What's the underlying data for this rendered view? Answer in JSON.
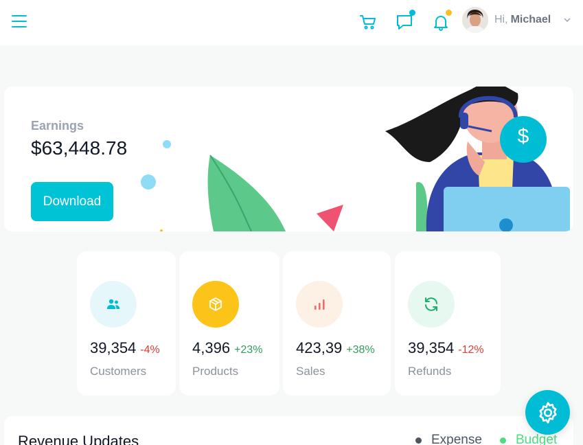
{
  "header": {
    "greeting": "Hi,",
    "user_name": "Michael",
    "icons": [
      "menu-icon",
      "cart-icon",
      "chat-icon",
      "bell-icon",
      "chevron-down-icon"
    ]
  },
  "earnings": {
    "label": "Earnings",
    "value": "$63,448.78",
    "download_label": "Download",
    "badge_symbol": "$"
  },
  "stats": [
    {
      "value": "39,354",
      "change": "-4%",
      "label": "Customers",
      "icon": "customers-icon"
    },
    {
      "value": "4,396",
      "change": "+23%",
      "label": "Products",
      "icon": "box-icon"
    },
    {
      "value": "423,39",
      "change": "+38%",
      "label": "Sales",
      "icon": "bar-chart-icon"
    },
    {
      "value": "39,354",
      "change": "-12%",
      "label": "Refunds",
      "icon": "refresh-icon"
    }
  ],
  "revenue": {
    "title": "Revenue Updates",
    "legend": [
      {
        "label": "Expense",
        "color": "#4b5563"
      },
      {
        "label": "Budget",
        "color": "#4ade80"
      }
    ]
  },
  "colors": {
    "accent": "#00bcd4",
    "positive": "#2e9e5b",
    "negative": "#e53935"
  }
}
